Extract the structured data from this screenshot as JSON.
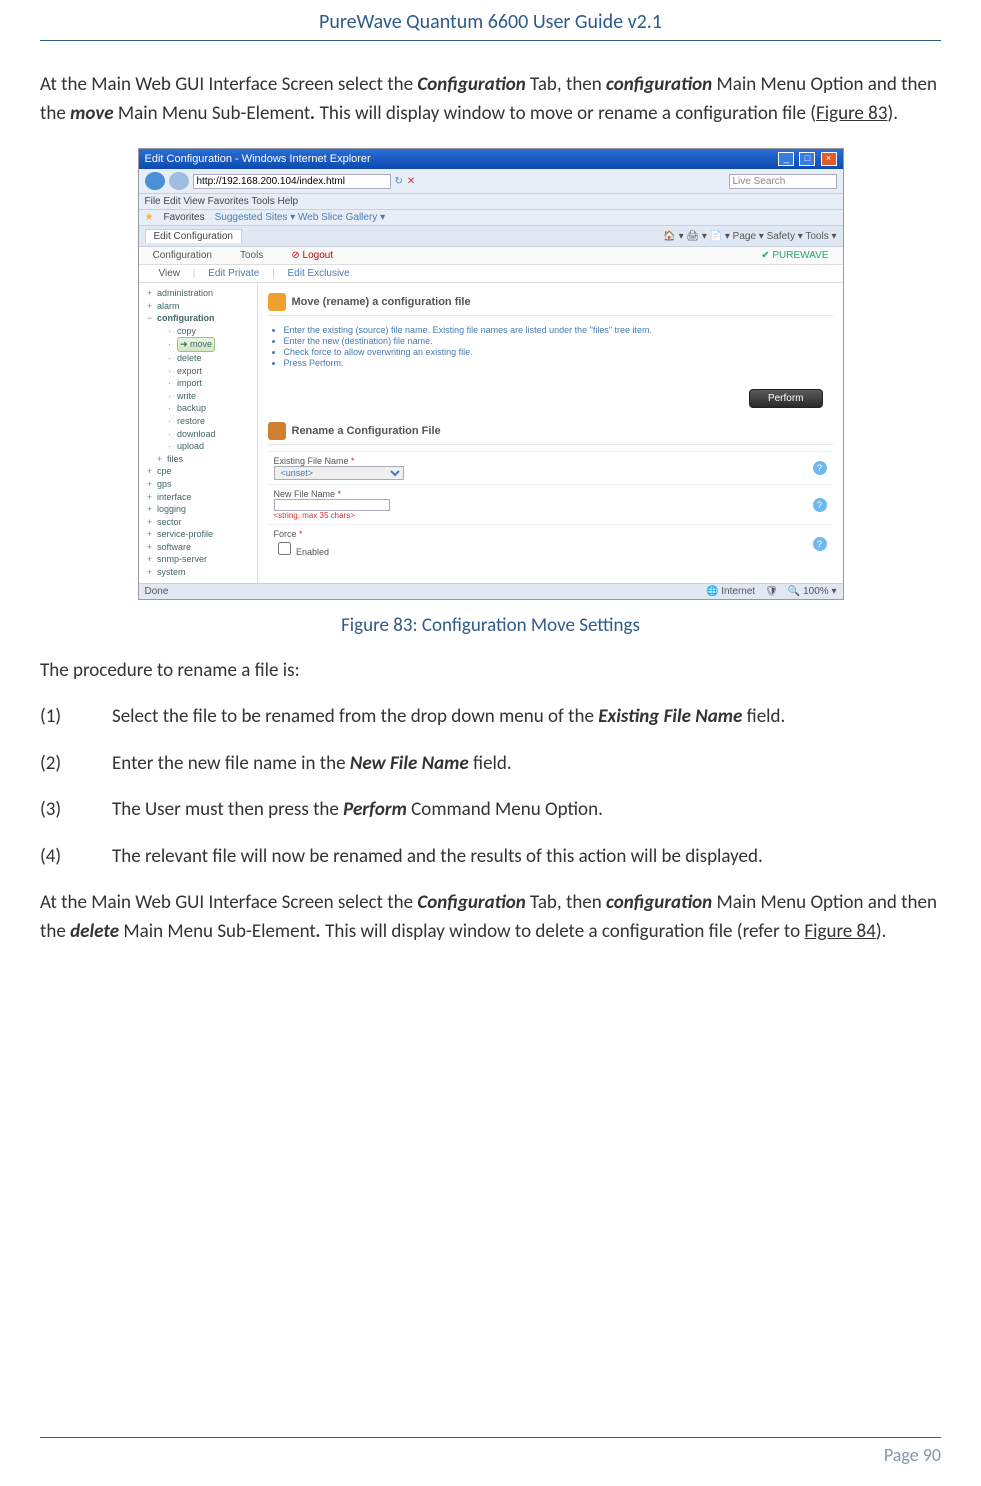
{
  "header": {
    "title": "PureWave Quantum 6600 User Guide v2.1"
  },
  "para1": {
    "t1": "At the Main Web GUI Interface Screen select the ",
    "b1": "Configuration",
    "t2": " Tab, then ",
    "b2": "configuration",
    "t3": " Main Menu Option and then the ",
    "b3": "move",
    "t4": " Main Menu Sub-Element",
    "b4": ".",
    "t5": " This will display window to move or rename a configuration file (",
    "ref": "Figure 83",
    "t6": ")."
  },
  "figure": {
    "caption": "Figure 83: Configuration Move Settings",
    "ie": {
      "title": "Edit Configuration - Windows Internet Explorer",
      "url": "http://192.168.200.104/index.html",
      "search_placeholder": "Live Search",
      "menu": "File   Edit   View   Favorites   Tools   Help",
      "fav_label": "Favorites",
      "fav_links": "Suggested Sites ▾   Web Slice Gallery ▾",
      "tab_label": "Edit Configuration",
      "right_tools": "Page ▾  Safety ▾  Tools ▾",
      "status_done": "Done",
      "status_net": "Internet",
      "status_zoom": "100%  ▾"
    },
    "app": {
      "top_config": "Configuration",
      "top_tools": "Tools",
      "top_logout": "Logout",
      "top_brand": "PUREWAVE",
      "viewbar": {
        "view": "View",
        "editp": "Edit Private",
        "edite": "Edit Exclusive",
        "sep": "|"
      },
      "tree": [
        {
          "lvl": "i1",
          "exp": "+",
          "label": "administration"
        },
        {
          "lvl": "i1",
          "exp": "+",
          "label": "alarm"
        },
        {
          "lvl": "i1",
          "exp": "−",
          "label": "configuration",
          "bold": true
        },
        {
          "lvl": "i3",
          "exp": "",
          "label": "copy"
        },
        {
          "lvl": "i3",
          "exp": "",
          "label": "move",
          "sel": true
        },
        {
          "lvl": "i3",
          "exp": "",
          "label": "delete"
        },
        {
          "lvl": "i3",
          "exp": "",
          "label": "export"
        },
        {
          "lvl": "i3",
          "exp": "",
          "label": "import"
        },
        {
          "lvl": "i3",
          "exp": "",
          "label": "write"
        },
        {
          "lvl": "i3",
          "exp": "",
          "label": "backup"
        },
        {
          "lvl": "i3",
          "exp": "",
          "label": "restore"
        },
        {
          "lvl": "i3",
          "exp": "",
          "label": "download"
        },
        {
          "lvl": "i3",
          "exp": "",
          "label": "upload"
        },
        {
          "lvl": "i2",
          "exp": "+",
          "label": "files"
        },
        {
          "lvl": "i1",
          "exp": "+",
          "label": "cpe"
        },
        {
          "lvl": "i1",
          "exp": "+",
          "label": "gps"
        },
        {
          "lvl": "i1",
          "exp": "+",
          "label": "interface"
        },
        {
          "lvl": "i1",
          "exp": "+",
          "label": "logging"
        },
        {
          "lvl": "i1",
          "exp": "+",
          "label": "sector"
        },
        {
          "lvl": "i1",
          "exp": "+",
          "label": "service-profile"
        },
        {
          "lvl": "i1",
          "exp": "+",
          "label": "software"
        },
        {
          "lvl": "i1",
          "exp": "+",
          "label": "snmp-server"
        },
        {
          "lvl": "i1",
          "exp": "+",
          "label": "system"
        }
      ],
      "sec1_title": "Move (rename) a configuration file",
      "instructions": [
        "Enter the existing (source) file name. Existing file names are listed under the \"files\" tree item.",
        "Enter the new (destination) file name.",
        "Check force to allow overwriting an existing file.",
        "Press Perform."
      ],
      "perform": "Perform",
      "sec2_title": "Rename a Configuration File",
      "form": {
        "existing_label": "Existing File Name",
        "existing_value": "<unset>",
        "new_label": "New File Name",
        "new_hint": "<string, max 35 chars>",
        "force_label": "Force",
        "force_check": "Enabled",
        "star": "*"
      }
    }
  },
  "proc_intro": "The procedure to rename a file is:",
  "steps": [
    {
      "n": "(1)",
      "pre": "Select the file to be renamed from the drop down menu of the ",
      "b": "Existing File Name",
      "post": " field."
    },
    {
      "n": "(2)",
      "pre": "Enter the new file name in the ",
      "b": "New File Name",
      "post": " field."
    },
    {
      "n": "(3)",
      "pre": "The User must then press the ",
      "b": "Perform",
      "post": " Command Menu Option."
    },
    {
      "n": "(4)",
      "pre": "The relevant file will now be renamed and the results of this action will be displayed.",
      "b": "",
      "post": ""
    }
  ],
  "para2": {
    "t1": "At the Main Web GUI Interface Screen select the ",
    "b1": "Configuration",
    "t2": " Tab, then ",
    "b2": "configuration",
    "t3": " Main Menu Option and then the ",
    "b3": "delete",
    "t4": " Main Menu Sub-Element",
    "b4": ".",
    "t5": " This will display window to delete a configuration file (refer to ",
    "ref": "Figure 84",
    "t6": ")."
  },
  "pagenum": "Page 90"
}
